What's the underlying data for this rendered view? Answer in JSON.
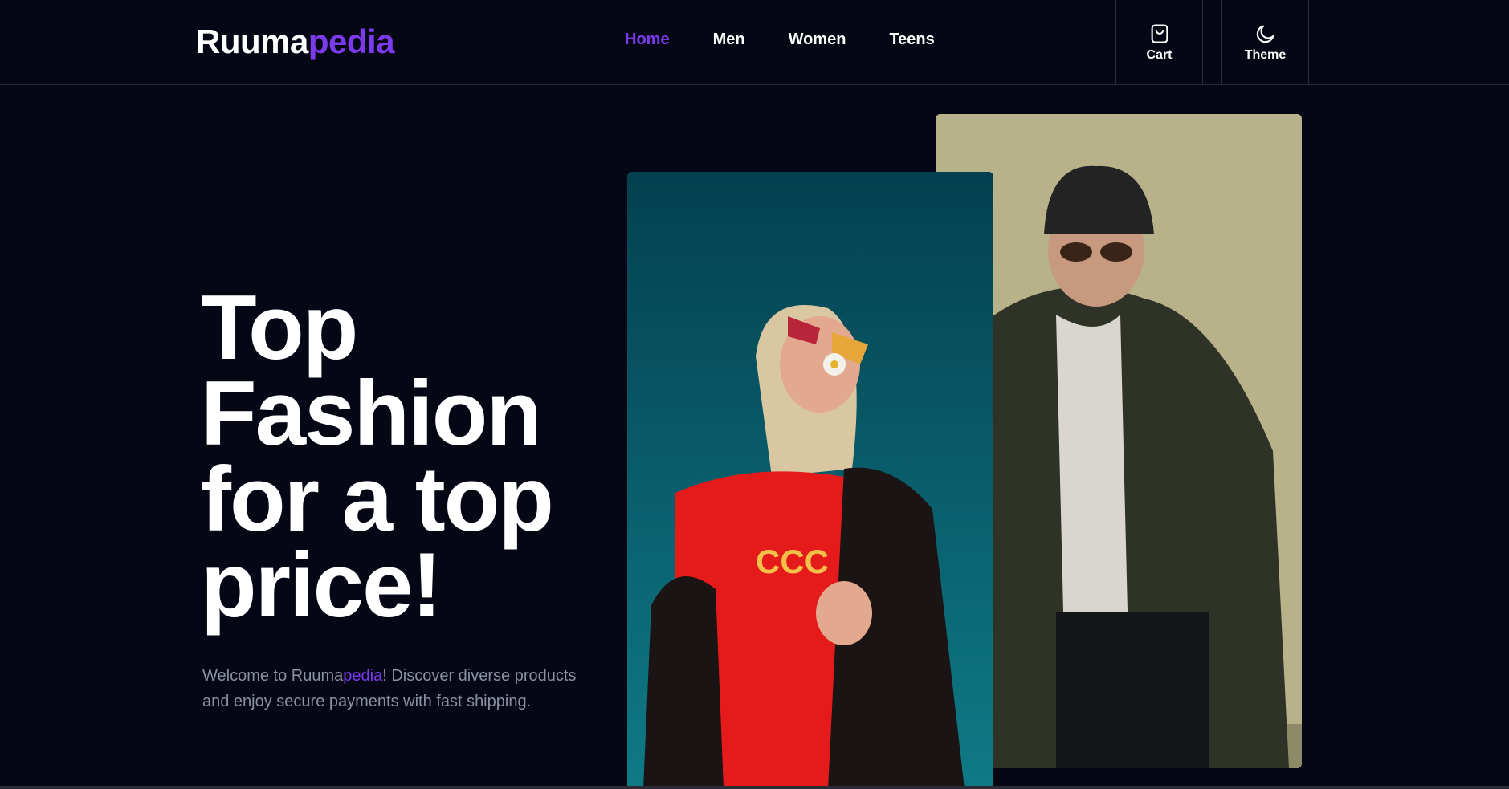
{
  "header": {
    "logo": {
      "part1": "Ruuma",
      "part2": "pedia"
    },
    "nav": [
      {
        "label": "Home",
        "active": true
      },
      {
        "label": "Men",
        "active": false
      },
      {
        "label": "Women",
        "active": false
      },
      {
        "label": "Teens",
        "active": false
      }
    ],
    "cart": {
      "label": "Cart",
      "icon": "shopping-bag-icon"
    },
    "theme": {
      "label": "Theme",
      "icon": "moon-icon"
    }
  },
  "hero": {
    "title": "Top Fashion for a top price!",
    "subtitle_prefix": "Welcome to Ruuma",
    "subtitle_brand": "pedia",
    "subtitle_suffix": "! Discover diverse products and enjoy secure payments with fast shipping."
  },
  "colors": {
    "background": "#050714",
    "accent": "#7c3aed",
    "muted_text": "#8a8fa3"
  }
}
